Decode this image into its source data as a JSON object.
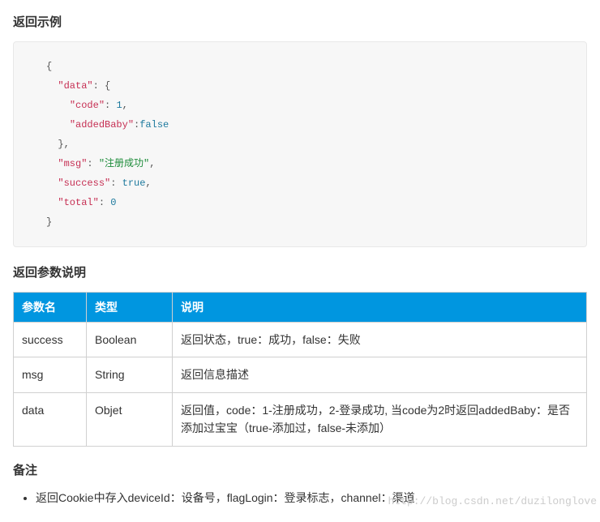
{
  "sections": {
    "response_example_title": "返回示例",
    "response_params_title": "返回参数说明",
    "notes_title": "备注"
  },
  "code_example": {
    "line0": "{",
    "line1_key": "\"data\"",
    "line1_punc": ": {",
    "line2_key": "\"code\"",
    "line2_punc1": ": ",
    "line2_val": "1",
    "line2_punc2": ",",
    "line3_key": "\"addedBaby\"",
    "line3_punc": ":",
    "line3_val": "false",
    "line4": "},",
    "line5_key": "\"msg\"",
    "line5_punc1": ": ",
    "line5_val": "\"注册成功\"",
    "line5_punc2": ",",
    "line6_key": "\"success\"",
    "line6_punc1": ": ",
    "line6_val": "true",
    "line6_punc2": ",",
    "line7_key": "\"total\"",
    "line7_punc1": ": ",
    "line7_val": "0",
    "line8": "}"
  },
  "params_table": {
    "headers": {
      "name": "参数名",
      "type": "类型",
      "desc": "说明"
    },
    "rows": [
      {
        "name": "success",
        "type": "Boolean",
        "desc": "返回状态，true：成功，false：失败"
      },
      {
        "name": "msg",
        "type": "String",
        "desc": "返回信息描述"
      },
      {
        "name": "data",
        "type": "Objet",
        "desc": "返回值，code：1-注册成功，2-登录成功, 当code为2时返回addedBaby：是否添加过宝宝（true-添加过，false-未添加）"
      }
    ]
  },
  "notes_item": "返回Cookie中存入deviceId：设备号，flagLogin：登录标志，channel：渠道",
  "watermark": "http://blog.csdn.net/duzilonglove"
}
